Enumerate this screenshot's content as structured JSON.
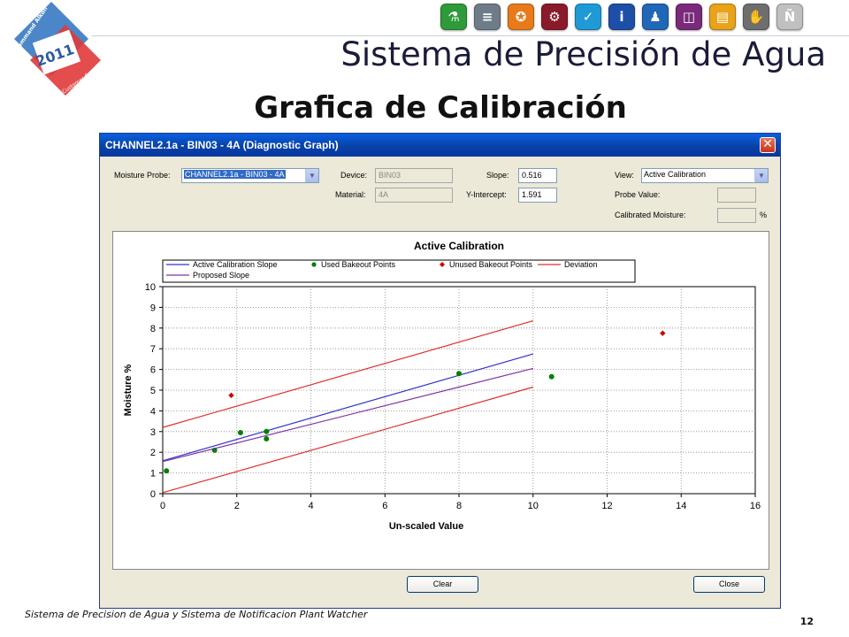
{
  "logo": {
    "line1": "Command Alkon",
    "year": "2011",
    "line2": "Customer Conference"
  },
  "header": {
    "title": "Sistema de Precisión de Agua",
    "subtitle": "Grafica de Calibración",
    "toolbar_icons": [
      {
        "name": "flask-icon",
        "color": "#2e9a3a",
        "glyph": "⚗"
      },
      {
        "name": "stack-icon",
        "color": "#6e7c8a",
        "glyph": "≡"
      },
      {
        "name": "stamp-icon",
        "color": "#e97a1a",
        "glyph": "✪"
      },
      {
        "name": "gears-icon",
        "color": "#8a1a2a",
        "glyph": "⚙"
      },
      {
        "name": "check-icon",
        "color": "#1f9ad6",
        "glyph": "✓"
      },
      {
        "name": "info-icon",
        "color": "#1d4fa8",
        "glyph": "i"
      },
      {
        "name": "person-icon",
        "color": "#2067b8",
        "glyph": "♟"
      },
      {
        "name": "panel-icon",
        "color": "#7a2a7a",
        "glyph": "◫"
      },
      {
        "name": "folder-icon",
        "color": "#e8a318",
        "glyph": "▤"
      },
      {
        "name": "hand-icon",
        "color": "#6e6e6e",
        "glyph": "✋"
      },
      {
        "name": "n-letter-icon",
        "color": "#c0c0c0",
        "glyph": "Ñ"
      }
    ]
  },
  "window": {
    "title": "CHANNEL2.1a - BIN03 - 4A (Diagnostic Graph)",
    "close_glyph": "✕",
    "moisture_probe_label": "Moisture Probe:",
    "moisture_probe_value": "CHANNEL2.1a - BIN03 - 4A",
    "device_label": "Device:",
    "device_value": "BIN03",
    "material_label": "Material:",
    "material_value": "4A",
    "slope_label": "Slope:",
    "slope_value": "0.516",
    "y_intercept_label": "Y-Intercept:",
    "y_intercept_value": "1.591",
    "view_label": "View:",
    "view_value": "Active Calibration",
    "probe_value_label": "Probe Value:",
    "probe_value": "",
    "calibrated_moisture_label": "Calibrated Moisture:",
    "calibrated_moisture_value": "",
    "percent_sign": "%",
    "clear_label": "Clear",
    "close_label": "Close"
  },
  "colors": {
    "active_slope": "#3333cc",
    "used_points": "#008000",
    "unused_points": "#cc0000",
    "deviation": "#e03030",
    "proposed_slope": "#8030a0"
  },
  "chart_data": {
    "type": "scatter",
    "title": "Active Calibration",
    "xlabel": "Un-scaled Value",
    "ylabel": "Moisture %",
    "xlim": [
      0,
      16
    ],
    "ylim": [
      0,
      10
    ],
    "xticks": [
      0,
      2,
      4,
      6,
      8,
      10,
      12,
      14,
      16
    ],
    "yticks": [
      0,
      1,
      2,
      3,
      4,
      5,
      6,
      7,
      8,
      9,
      10
    ],
    "grid": true,
    "legend_position": "top",
    "series": [
      {
        "name": "Active Calibration Slope",
        "kind": "line",
        "x": [
          0,
          10
        ],
        "y": [
          1.59,
          6.75
        ]
      },
      {
        "name": "Used Bakeout Points",
        "kind": "points",
        "marker": "circle",
        "x": [
          0.1,
          1.4,
          2.1,
          2.8,
          2.8,
          8.0,
          10.5
        ],
        "y": [
          1.1,
          2.1,
          2.95,
          3.0,
          2.65,
          5.8,
          5.65
        ]
      },
      {
        "name": "Unused Bakeout Points",
        "kind": "points",
        "marker": "diamond",
        "x": [
          1.85,
          13.5
        ],
        "y": [
          4.75,
          7.75
        ]
      },
      {
        "name": "Deviation",
        "kind": "line",
        "x": [
          0,
          10
        ],
        "y": [
          3.2,
          8.35
        ]
      },
      {
        "name": "Deviation",
        "kind": "line",
        "x": [
          0,
          10
        ],
        "y": [
          0.05,
          5.15
        ],
        "hide_legend": true
      },
      {
        "name": "Proposed Slope",
        "kind": "line",
        "x": [
          0,
          10
        ],
        "y": [
          1.55,
          6.05
        ]
      }
    ]
  },
  "footer": {
    "text": "Sistema de Precision de Agua y Sistema de Notificacion Plant Watcher",
    "page": "12"
  }
}
